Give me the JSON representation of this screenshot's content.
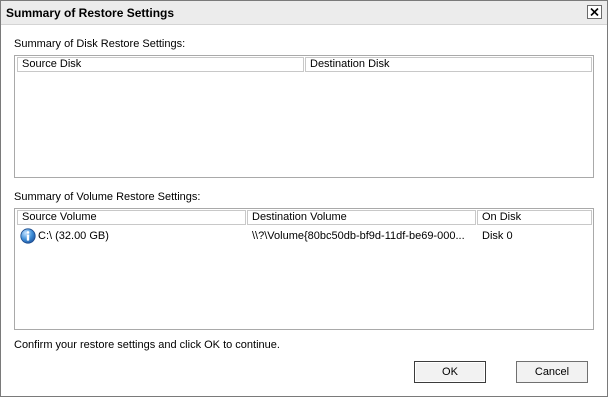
{
  "window": {
    "title": "Summary of Restore Settings"
  },
  "disk_section": {
    "label": "Summary of Disk Restore Settings:",
    "columns": [
      "Source Disk",
      "Destination Disk"
    ]
  },
  "volume_section": {
    "label": "Summary of Volume Restore Settings:",
    "columns": [
      "Source Volume",
      "Destination Volume",
      "On Disk"
    ],
    "rows": [
      {
        "icon": "info-icon",
        "source": "C:\\ (32.00 GB)",
        "destination": "\\\\?\\Volume{80bc50db-bf9d-11df-be69-000...",
        "on_disk": "Disk 0"
      }
    ]
  },
  "confirm_text": "Confirm your restore settings and click OK to continue.",
  "buttons": {
    "ok": "OK",
    "cancel": "Cancel"
  }
}
